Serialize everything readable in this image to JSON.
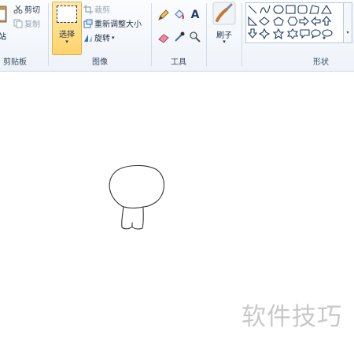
{
  "ribbon": {
    "clipboard": {
      "paste_label": "站",
      "cut_label": "剪切",
      "copy_label": "复制",
      "group_label": "剪贴板"
    },
    "image": {
      "select_label": "选择",
      "select_arrow": "▾",
      "crop_label": "裁剪",
      "resize_label": "重新调整大小",
      "rotate_label": "旋转",
      "rotate_arrow": "▾",
      "group_label": "图像"
    },
    "tools": {
      "text_tool_glyph": "A",
      "group_label": "工具"
    },
    "brushes": {
      "label": "刷子",
      "arrow": "▾"
    },
    "shapes": {
      "group_label": "形状",
      "scroll_glyph": "▾"
    }
  },
  "watermark": "软件技巧",
  "colors": {
    "ribbon_bg": "#eef3fa",
    "select_active": "#ffd36b",
    "watermark": "#c8c8c8"
  }
}
